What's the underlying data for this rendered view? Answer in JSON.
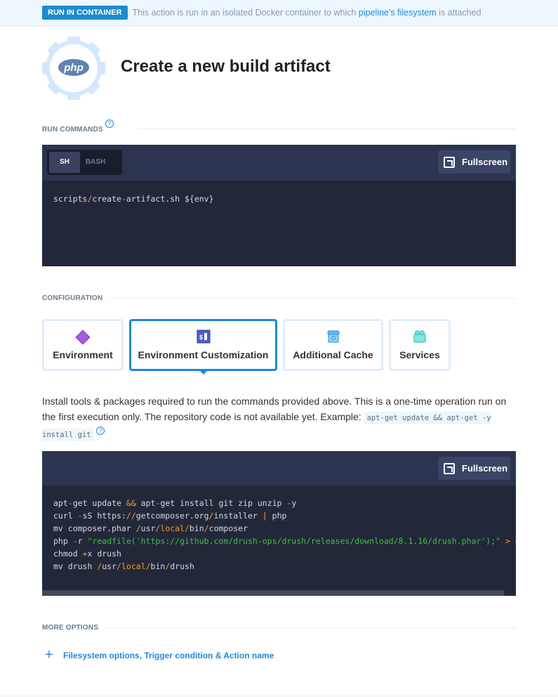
{
  "banner": {
    "badge": "RUN IN CONTAINER",
    "text_before": "This action is run in an isolated Docker container to which ",
    "link": "pipeline's filesystem",
    "text_after": " is attached"
  },
  "header": {
    "logo": "php",
    "title": "Create a new build artifact"
  },
  "run_commands": {
    "label": "RUN COMMANDS",
    "tabs": [
      "SH",
      "BASH"
    ],
    "active_tab": "SH",
    "fullscreen": "Fullscreen",
    "code": [
      "scripts/create-artifact.sh ${env}"
    ]
  },
  "configuration": {
    "label": "CONFIGURATION",
    "cards": [
      {
        "label": "Environment",
        "icon": "diamond-icon"
      },
      {
        "label": "Environment Customization",
        "icon": "terminal-icon",
        "active": true
      },
      {
        "label": "Additional Cache",
        "icon": "cache-box-icon"
      },
      {
        "label": "Services",
        "icon": "services-icon"
      }
    ],
    "description": "Install tools & packages required to run the commands provided above. This is a one-time operation run on the first execution only. The repository code is not available yet. Example: ",
    "example": "apt-get update && apt-get -y install git",
    "fullscreen": "Fullscreen",
    "code": [
      "apt-get update && apt-get install git zip unzip -y",
      "curl -sS https://getcomposer.org/installer | php",
      "mv composer.phar /usr/local/bin/composer",
      "php -r \"readfile('https://github.com/drush-ops/drush/releases/download/8.1.16/drush.phar');\" > drush",
      "chmod +x drush",
      "mv drush /usr/local/bin/drush"
    ]
  },
  "more_options": {
    "label": "MORE OPTIONS",
    "link": "Filesystem options, Trigger condition & Action name"
  },
  "colors": {
    "accent": "#1e88e5",
    "badge": "#1b8bcf",
    "editor_bg": "#222839",
    "editor_header": "#2d3450"
  }
}
